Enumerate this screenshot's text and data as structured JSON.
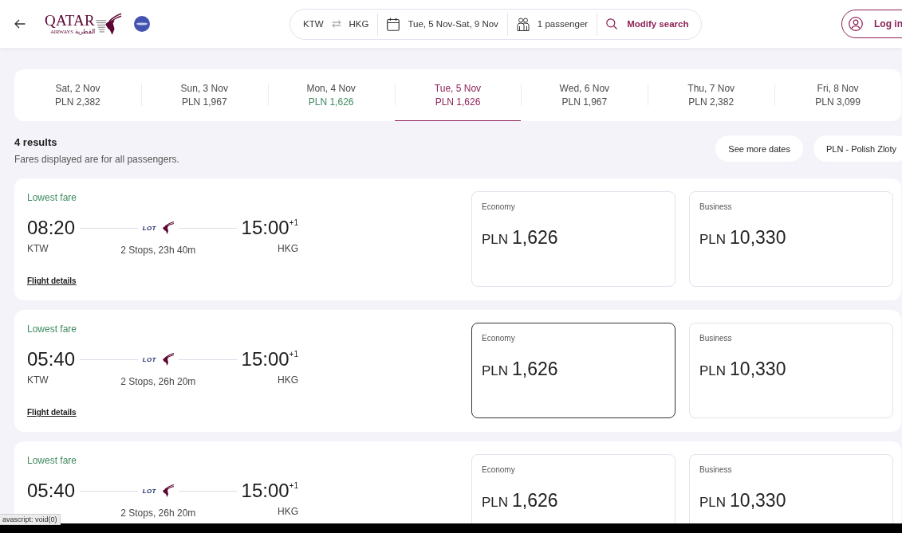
{
  "header": {
    "logo": {
      "wordmark": "QATAR",
      "subtitle": "AIRWAYS",
      "arabic": "القطرية"
    },
    "search": {
      "origin": "KTW",
      "destination": "HKG",
      "dates": "Tue, 5 Nov-Sat, 9 Nov",
      "passengers": "1 passenger",
      "action": "Modify search"
    },
    "login": "Log in"
  },
  "date_tabs": [
    {
      "date": "Sat, 2 Nov",
      "price": "PLN 2,382",
      "selected": false,
      "lowest": false
    },
    {
      "date": "Sun, 3 Nov",
      "price": "PLN 1,967",
      "selected": false,
      "lowest": false
    },
    {
      "date": "Mon, 4 Nov",
      "price": "PLN 1,626",
      "selected": false,
      "lowest": true
    },
    {
      "date": "Tue, 5 Nov",
      "price": "PLN 1,626",
      "selected": true,
      "lowest": false
    },
    {
      "date": "Wed, 6 Nov",
      "price": "PLN 1,967",
      "selected": false,
      "lowest": false
    },
    {
      "date": "Thu, 7 Nov",
      "price": "PLN 2,382",
      "selected": false,
      "lowest": false
    },
    {
      "date": "Fri, 8 Nov",
      "price": "PLN 3,099",
      "selected": false,
      "lowest": false
    }
  ],
  "results": {
    "count": "4 results",
    "note": "Fares displayed are for all passengers.",
    "more_dates_button": "See more dates",
    "currency_button": "PLN - Polish Zloty"
  },
  "flights": [
    {
      "tag": "Lowest fare",
      "departure": {
        "time": "08:20",
        "airport": "KTW"
      },
      "carrier_logo": "LOT",
      "stops": "2 Stops, 23h 40m",
      "arrival": {
        "time": "15:00",
        "day_offset": "+1",
        "airport": "HKG"
      },
      "details_link": "Flight details",
      "fares": [
        {
          "cabin": "Economy",
          "currency": "PLN",
          "amount": "1,626",
          "selected": false
        },
        {
          "cabin": "Business",
          "currency": "PLN",
          "amount": "10,330",
          "selected": false
        }
      ]
    },
    {
      "tag": "Lowest fare",
      "departure": {
        "time": "05:40",
        "airport": "KTW"
      },
      "carrier_logo": "LOT",
      "stops": "2 Stops, 26h 20m",
      "arrival": {
        "time": "15:00",
        "day_offset": "+1",
        "airport": "HKG"
      },
      "details_link": "Flight details",
      "fares": [
        {
          "cabin": "Economy",
          "currency": "PLN",
          "amount": "1,626",
          "selected": true
        },
        {
          "cabin": "Business",
          "currency": "PLN",
          "amount": "10,330",
          "selected": false
        }
      ]
    },
    {
      "tag": "Lowest fare",
      "departure": {
        "time": "05:40"
      },
      "carrier_logo": "LOT",
      "stops": "2 Stops, 26h 20m",
      "arrival": {
        "time": "15:00",
        "day_offset": "+1",
        "airport": "HKG"
      },
      "fares": [
        {
          "cabin": "Economy",
          "currency": "PLN",
          "amount": "1,626",
          "selected": false
        },
        {
          "cabin": "Business",
          "currency": "PLN",
          "amount": "10,330",
          "selected": false
        }
      ]
    }
  ],
  "status_tooltip": "avascript: void(0)"
}
